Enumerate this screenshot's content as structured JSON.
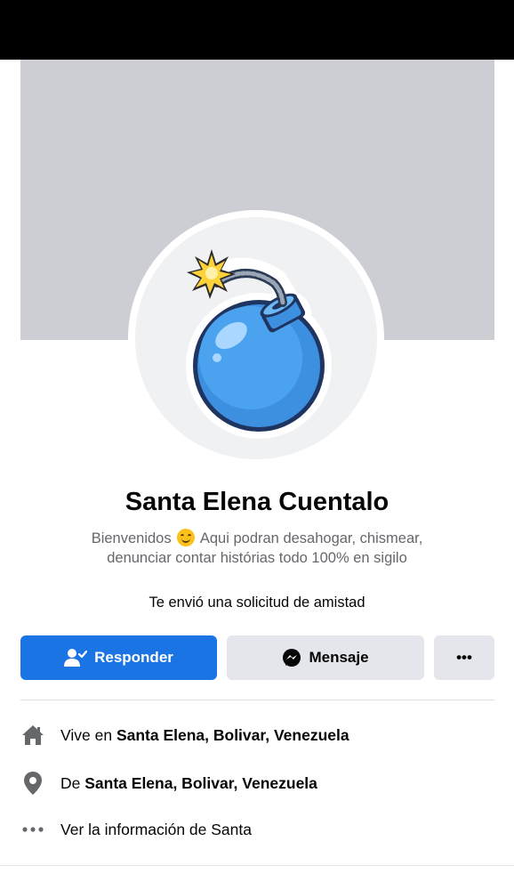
{
  "profile": {
    "name": "Santa Elena Cuentalo",
    "bio_line1_before": "Bienvenidos",
    "bio_line1_after": "Aqui podran desahogar, chismear,",
    "bio_line2": "denunciar contar histórias todo 100% en sigilo",
    "bio_emoji": "smiling-face-emoji",
    "avatar_icon": "bomb-icon"
  },
  "friend_request_text": "Te envió una solicitud de amistad",
  "actions": {
    "respond_label": "Responder",
    "message_label": "Mensaje",
    "more_label": "•••"
  },
  "info": {
    "lives_prefix": "Vive en",
    "lives_place": "Santa Elena, Bolivar, Venezuela",
    "from_prefix": "De",
    "from_place": "Santa Elena, Bolivar, Venezuela",
    "about_link": "Ver la información de Santa"
  },
  "colors": {
    "primary_button": "#1b74e4",
    "secondary_button": "#e4e6eb",
    "cover": "#ccced3",
    "secondary_text": "#65676b",
    "icon_gray": "#65676b"
  }
}
